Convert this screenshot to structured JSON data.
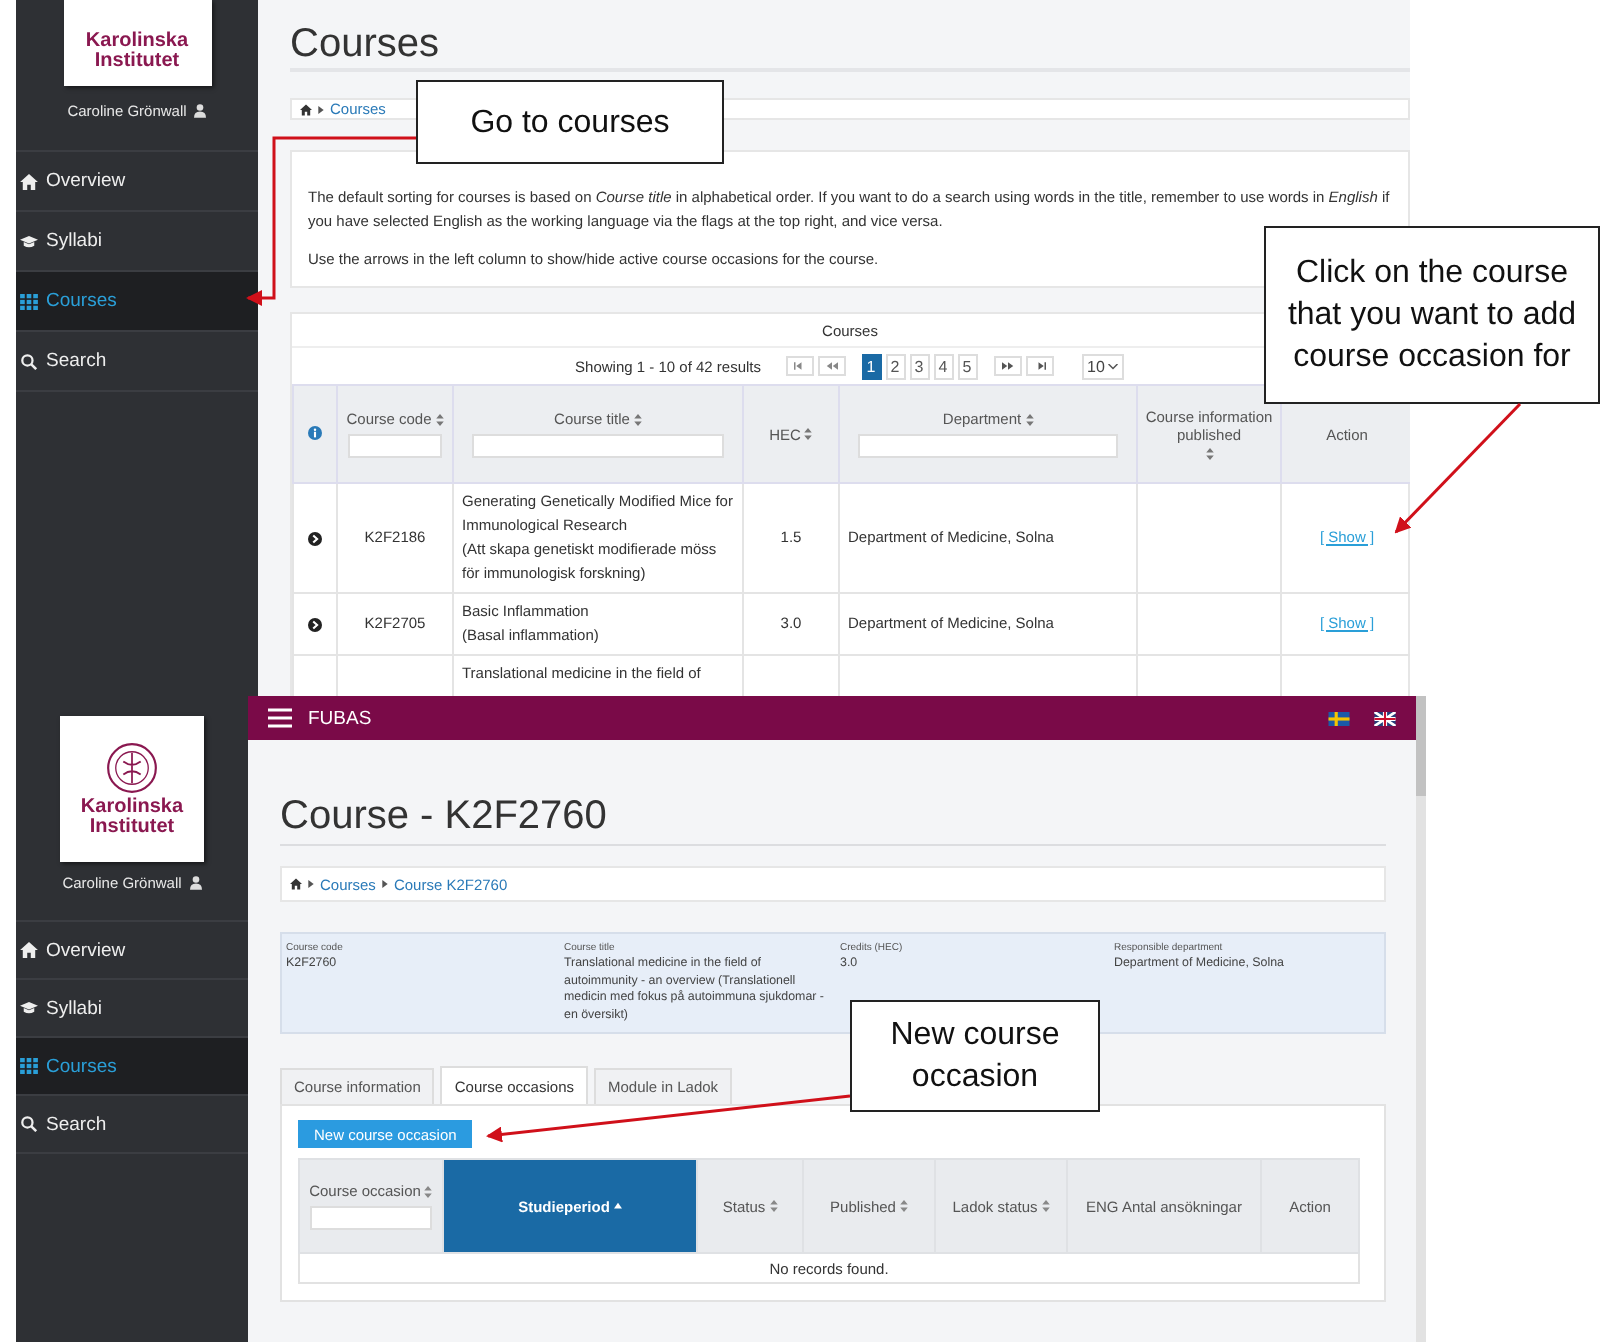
{
  "course_list_screen": {
    "sidebar": {
      "logo_text": "Karolinska Institutet",
      "user": "Caroline Grönwall",
      "items": [
        {
          "label": "Overview",
          "selected": false
        },
        {
          "label": "Syllabi",
          "selected": false
        },
        {
          "label": "Courses",
          "selected": true
        },
        {
          "label": "Search",
          "selected": false
        }
      ]
    },
    "title": "Courses",
    "breadcrumb": [
      "Courses"
    ],
    "info": [
      "The default sorting for courses is based on *Course title* in alphabetical order. If you want to do a search using words in the title, remember to use words in *English* if you have selected English as the working language via the flags at the top right, and vice versa.",
      "Use the arrows in the left column to show/hide active course occasions for the course."
    ],
    "table": {
      "caption": "Courses",
      "showing": "Showing 1 - 10 of 42 results",
      "pages": [
        {
          "label": "1",
          "selected": true
        },
        {
          "label": "2",
          "selected": false
        },
        {
          "label": "3",
          "selected": false
        },
        {
          "label": "4",
          "selected": false
        },
        {
          "label": "5",
          "selected": false
        }
      ],
      "page_size": "10",
      "columns": [
        {
          "kind": "info"
        },
        {
          "kind": "text",
          "label": "Course code",
          "sortable": true,
          "filter": true
        },
        {
          "kind": "text",
          "label": "Course title",
          "sortable": true,
          "filter": true
        },
        {
          "kind": "text",
          "label": "HEC",
          "sortable": true,
          "filter": false
        },
        {
          "kind": "text",
          "label": "Department",
          "sortable": true,
          "filter": true
        },
        {
          "kind": "text",
          "label": "Course information published",
          "sortable": true,
          "filter": false
        },
        {
          "kind": "text",
          "label": "Action",
          "sortable": false,
          "filter": false
        }
      ],
      "rows": [
        {
          "code": "K2F2186",
          "title": "Generating Genetically Modified Mice for Immunological Research",
          "title_sv": "(Att skapa genetiskt modifierade möss för immunologisk forskning)",
          "hec": "1.5",
          "department": "Department of Medicine, Solna",
          "action": "[ Show ]"
        },
        {
          "code": "K2F2705",
          "title": "Basic Inflammation",
          "title_sv": "(Basal inflammation)",
          "hec": "3.0",
          "department": "Department of Medicine, Solna",
          "action": "[ Show ]"
        },
        {
          "title": "Translational medicine in the field of"
        }
      ]
    }
  },
  "course_detail_screen": {
    "app_name": "FUBAS",
    "sidebar": {
      "logo_text": "Karolinska Institutet",
      "user": "Caroline Grönwall",
      "items": [
        {
          "label": "Overview",
          "selected": false
        },
        {
          "label": "Syllabi",
          "selected": false
        },
        {
          "label": "Courses",
          "selected": true
        },
        {
          "label": "Search",
          "selected": false
        }
      ]
    },
    "title": "Course - K2F2760",
    "breadcrumb": [
      "Courses",
      "Course K2F2760"
    ],
    "fields": [
      {
        "label": "Course code",
        "value": "K2F2760"
      },
      {
        "label": "Course title",
        "value": "Translational medicine in the field of autoimmunity - an overview (Translationell medicin med fokus på autoimmuna sjukdomar - en översikt)"
      },
      {
        "label": "Credits (HEC)",
        "value": "3.0"
      },
      {
        "label": "Responsible department",
        "value": "Department of Medicine, Solna"
      }
    ],
    "tabs": [
      {
        "label": "Course information",
        "selected": false
      },
      {
        "label": "Course occasions",
        "selected": true
      },
      {
        "label": "Module in Ladok",
        "selected": false
      }
    ],
    "new_button": "New course occasion",
    "table": {
      "columns": [
        {
          "label": "Course occasion",
          "sortable": true,
          "filter": true,
          "sorted": false
        },
        {
          "label": "Studieperiod",
          "sortable": true,
          "filter": false,
          "sorted": true
        },
        {
          "label": "Status",
          "sortable": true,
          "filter": false,
          "sorted": false
        },
        {
          "label": "Published",
          "sortable": true,
          "filter": false,
          "sorted": false
        },
        {
          "label": "Ladok status",
          "sortable": true,
          "filter": false,
          "sorted": false
        },
        {
          "label": "ENG Antal ansökningar",
          "sortable": false,
          "filter": false,
          "sorted": false
        },
        {
          "label": "Action",
          "sortable": false,
          "filter": false,
          "sorted": false
        }
      ],
      "empty_text": "No records found."
    }
  },
  "callouts": [
    {
      "text": "Go to courses"
    },
    {
      "text": "Click on the course that you want to add course occasion for"
    },
    {
      "text": "New course occasion"
    }
  ]
}
